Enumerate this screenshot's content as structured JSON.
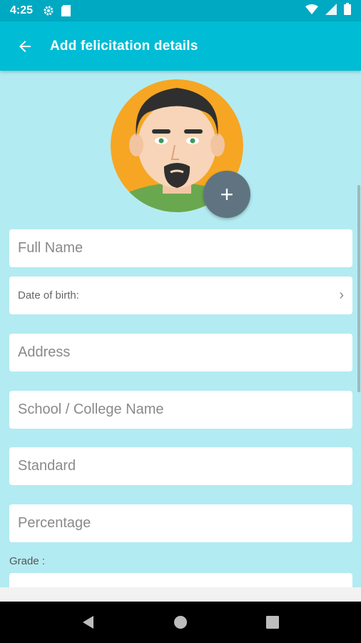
{
  "status_bar": {
    "time": "4:25",
    "icons": [
      "gear-icon",
      "sd-card-icon",
      "wifi-icon",
      "signal-icon",
      "battery-icon"
    ]
  },
  "app_bar": {
    "title": "Add felicitation details",
    "back_icon": "arrow-left-icon"
  },
  "avatar": {
    "add_label": "+"
  },
  "form": {
    "full_name_placeholder": "Full Name",
    "dob_label": "Date of birth:",
    "dob_chevron": "›",
    "address_placeholder": "Address",
    "school_placeholder": "School / College Name",
    "standard_placeholder": "Standard",
    "percentage_placeholder": "Percentage",
    "grade_label": "Grade :"
  },
  "nav_bar": {
    "back": "nav-back-icon",
    "home": "nav-home-icon",
    "recents": "nav-recents-icon"
  },
  "colors": {
    "status_bar": "#00a9c2",
    "app_bar": "#00bcd4",
    "background": "#b3ebf2",
    "fab": "#5f7480"
  }
}
